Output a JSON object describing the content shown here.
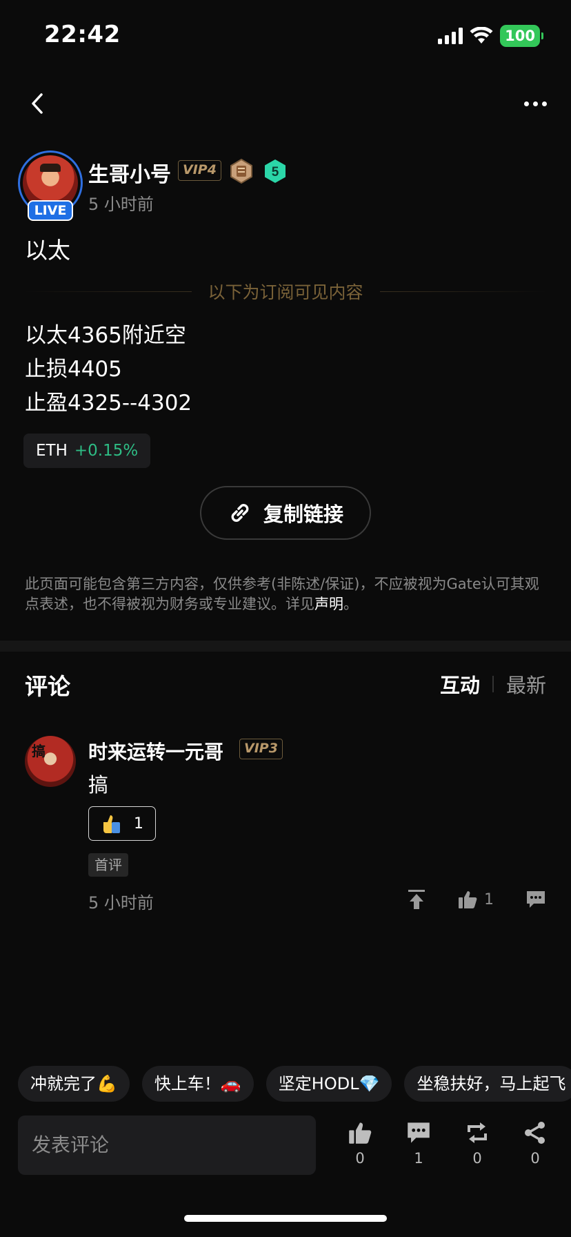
{
  "status": {
    "time": "22:42",
    "battery": "100"
  },
  "author": {
    "name": "生哥小号",
    "vip": "VIP4",
    "level": "5",
    "live": "LIVE",
    "time": "5 小时前"
  },
  "post": {
    "title": "以太",
    "subscription_divider": "以下为订阅可见内容",
    "lines": [
      "以太4365附近空",
      "止损4405",
      "止盈4325--4302"
    ],
    "ticker": {
      "symbol": "ETH",
      "change": "+0.15%"
    }
  },
  "copy_link_label": "复制链接",
  "disclaimer": {
    "text": "此页面可能包含第三方内容，仅供参考(非陈述/保证)，不应被视为Gate认可其观点表述，也不得被视为财务或专业建议。详见",
    "link": "声明",
    "end": "。"
  },
  "comments": {
    "title": "评论",
    "sort": {
      "active": "互动",
      "inactive": "最新"
    },
    "items": [
      {
        "name": "时来运转一元哥",
        "vip": "VIP3",
        "text": "搞",
        "reaction_count": "1",
        "tag": "首评",
        "time": "5 小时前",
        "like_count": "1"
      }
    ]
  },
  "quick_replies": [
    "冲就完了💪",
    "快上车！🚗",
    "坚定HODL💎",
    "坐稳扶好，马上起飞"
  ],
  "bottom_bar": {
    "placeholder": "发表评论",
    "likes": "0",
    "comments": "1",
    "reposts": "0",
    "shares": "0"
  }
}
